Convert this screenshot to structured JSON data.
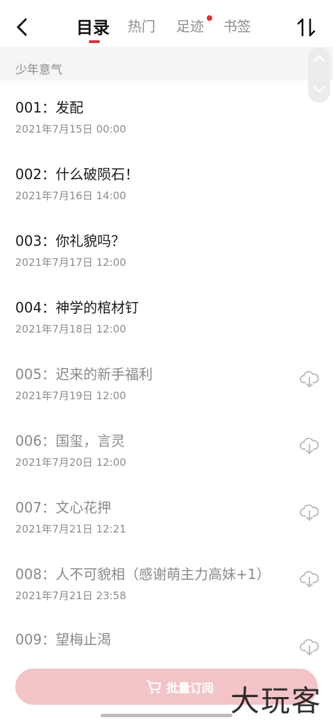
{
  "tabs": [
    {
      "label": "目录"
    },
    {
      "label": "热门"
    },
    {
      "label": "足迹"
    },
    {
      "label": "书签"
    }
  ],
  "volume_title": "少年意气",
  "chapters": [
    {
      "title": "001：发配",
      "date": "2021年7月15日 00:00",
      "locked": false
    },
    {
      "title": "002：什么破陨石！",
      "date": "2021年7月16日 14:00",
      "locked": false
    },
    {
      "title": "003：你礼貌吗？",
      "date": "2021年7月17日 12:00",
      "locked": false
    },
    {
      "title": "004：神学的棺材钉",
      "date": "2021年7月18日 12:00",
      "locked": false
    },
    {
      "title": "005：迟来的新手福利",
      "date": "2021年7月19日 12:00",
      "locked": true
    },
    {
      "title": "006：国玺，言灵",
      "date": "2021年7月20日 12:00",
      "locked": true
    },
    {
      "title": "007：文心花押",
      "date": "2021年7月21日 12:21",
      "locked": true
    },
    {
      "title": "008：人不可貌相（感谢萌主力高妹+1）",
      "date": "2021年7月21日 23:58",
      "locked": true
    },
    {
      "title": "009：望梅止渴",
      "date": "",
      "locked": true
    }
  ],
  "batch_button": {
    "label": "批量订阅"
  },
  "watermark": "大玩客",
  "colors": {
    "accent": "#d8333b",
    "button_bg": "#f3c4c7",
    "muted": "#8c8c8c"
  },
  "icons": {
    "back": "chevron-left-icon",
    "sort": "sort-icon",
    "download": "cloud-download-icon",
    "cart": "cart-icon"
  }
}
